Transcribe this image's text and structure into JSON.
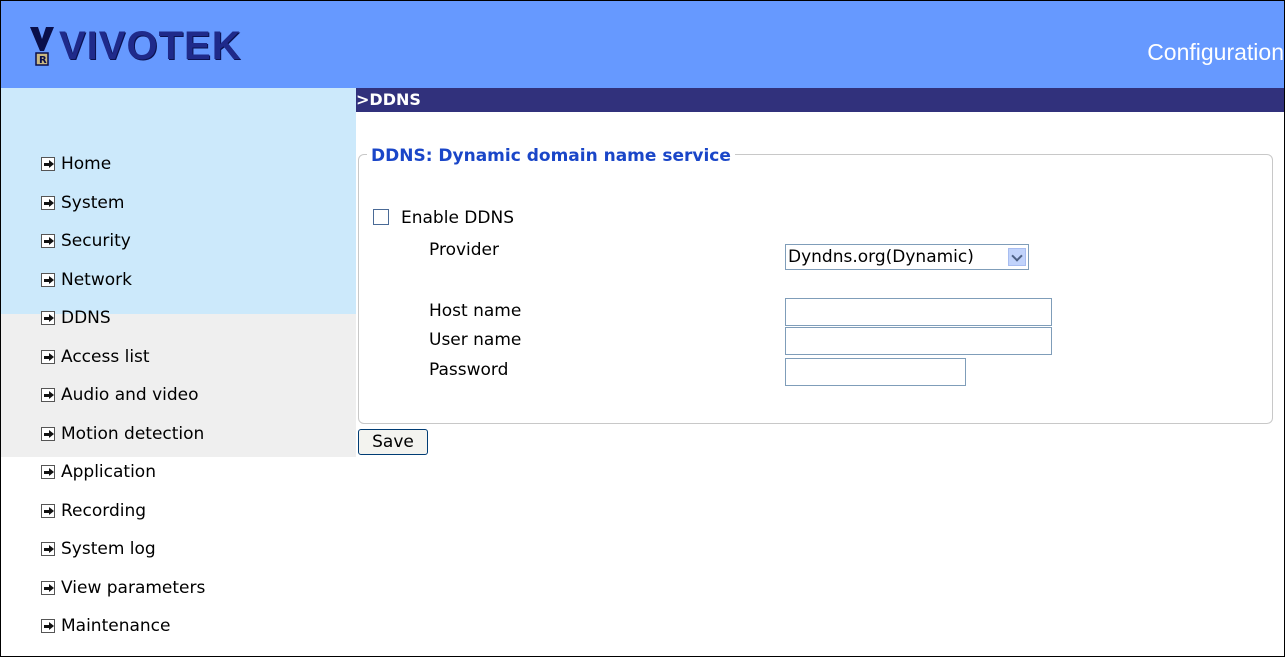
{
  "header": {
    "logo_text": "VIVOTEK",
    "title": "Configuration",
    "bg_color": "#6699ff"
  },
  "sidebar": {
    "items": [
      {
        "label": "Home"
      },
      {
        "label": "System"
      },
      {
        "label": "Security"
      },
      {
        "label": "Network"
      },
      {
        "label": "DDNS"
      },
      {
        "label": "Access list"
      },
      {
        "label": "Audio and video"
      },
      {
        "label": "Motion detection"
      },
      {
        "label": "Application"
      },
      {
        "label": "Recording"
      },
      {
        "label": "System log"
      },
      {
        "label": "View parameters"
      },
      {
        "label": "Maintenance"
      }
    ]
  },
  "main": {
    "section_title": ">DDNS",
    "fieldset_legend": "DDNS: Dynamic domain name service",
    "enable_label": "Enable DDNS",
    "enable_checked": false,
    "provider_label": "Provider",
    "provider_value": "Dyndns.org(Dynamic)",
    "host_label": "Host name",
    "host_value": "",
    "user_label": "User name",
    "user_value": "",
    "password_label": "Password",
    "password_value": "",
    "save_label": "Save"
  }
}
